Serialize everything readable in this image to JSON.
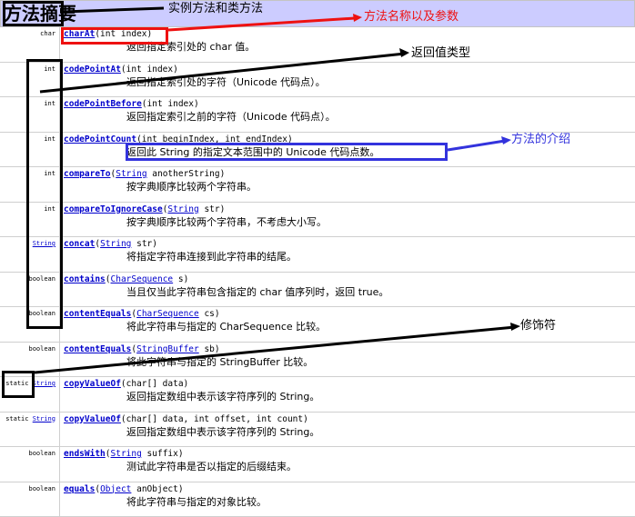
{
  "summary_title": "方法摘要",
  "methods": [
    {
      "modifier": "char",
      "modifier_link": "",
      "name": "charAt",
      "params": [
        "(int index)"
      ],
      "description": "返回指定索引处的 char 值。"
    },
    {
      "modifier": "int",
      "modifier_link": "",
      "name": "codePointAt",
      "params": [
        "(int index)"
      ],
      "description": "返回指定索引处的字符（Unicode 代码点）。"
    },
    {
      "modifier": "int",
      "modifier_link": "",
      "name": "codePointBefore",
      "params": [
        "(int index)"
      ],
      "description": "返回指定索引之前的字符（Unicode 代码点）。"
    },
    {
      "modifier": "int",
      "modifier_link": "",
      "name": "codePointCount",
      "params": [
        "(int beginIndex, int endIndex)"
      ],
      "description": "返回此 String 的指定文本范围中的 Unicode 代码点数。"
    },
    {
      "modifier": "int",
      "modifier_link": "",
      "name": "compareTo",
      "params": [
        "(",
        "String",
        " anotherString)"
      ],
      "description": "按字典顺序比较两个字符串。"
    },
    {
      "modifier": "int",
      "modifier_link": "",
      "name": "compareToIgnoreCase",
      "params": [
        "(",
        "String",
        " str)"
      ],
      "description": "按字典顺序比较两个字符串，不考虑大小写。"
    },
    {
      "modifier": "",
      "modifier_link": "String",
      "name": "concat",
      "params": [
        "(",
        "String",
        " str)"
      ],
      "description": "将指定字符串连接到此字符串的结尾。"
    },
    {
      "modifier": "boolean",
      "modifier_link": "",
      "name": "contains",
      "params": [
        "(",
        "CharSequence",
        " s)"
      ],
      "description": "当且仅当此字符串包含指定的 char 值序列时，返回 true。"
    },
    {
      "modifier": "boolean",
      "modifier_link": "",
      "name": "contentEquals",
      "params": [
        "(",
        "CharSequence",
        " cs)"
      ],
      "description": "将此字符串与指定的 CharSequence 比较。"
    },
    {
      "modifier": "boolean",
      "modifier_link": "",
      "name": "contentEquals",
      "params": [
        "(",
        "StringBuffer",
        " sb)"
      ],
      "description": "将此字符串与指定的 StringBuffer 比较。"
    },
    {
      "modifier": "static",
      "modifier_link": "String",
      "name": "copyValueOf",
      "params": [
        "(char[] data)"
      ],
      "description": "返回指定数组中表示该字符序列的 String。"
    },
    {
      "modifier": "static",
      "modifier_link": "String",
      "name": "copyValueOf",
      "params": [
        "(char[] data, int offset, int count)"
      ],
      "description": "返回指定数组中表示该字符序列的 String。"
    },
    {
      "modifier": "boolean",
      "modifier_link": "",
      "name": "endsWith",
      "params": [
        "(",
        "String",
        " suffix)"
      ],
      "description": "测试此字符串是否以指定的后缀结束。"
    },
    {
      "modifier": "boolean",
      "modifier_link": "",
      "name": "equals",
      "params": [
        "(",
        "Object",
        " anObject)"
      ],
      "description": "将此字符串与指定的对象比较。"
    }
  ],
  "annotations": {
    "instance_static": "实例方法和类方法",
    "name_params": "方法名称以及参数",
    "return_type": "返回值类型",
    "method_intro": "方法的介绍",
    "modifier": "修饰符"
  },
  "colors": {
    "header_bg": "#ccccff",
    "link": "#0000cc",
    "annotation_red": "#ee1111",
    "annotation_blue": "#3333dd",
    "annotation_black": "#000000"
  }
}
